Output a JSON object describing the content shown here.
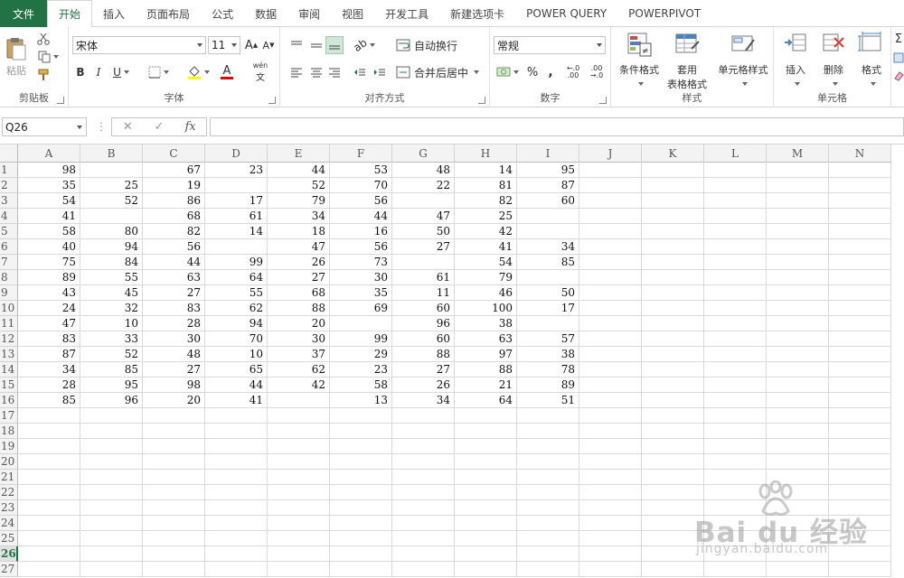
{
  "ribbon_tabs": [
    "文件",
    "开始",
    "插入",
    "页面布局",
    "公式",
    "数据",
    "审阅",
    "视图",
    "开发工具",
    "新建选项卡",
    "POWER QUERY",
    "POWERPIVOT"
  ],
  "active_tab": "开始",
  "clipboard": {
    "label": "剪贴板",
    "paste": "粘贴"
  },
  "font": {
    "label": "字体",
    "name": "宋体",
    "size": "11",
    "bold": "B",
    "italic": "I",
    "underline": "U",
    "grow": "A",
    "shrink": "A",
    "font_color": "A",
    "phonetic": "wén"
  },
  "alignment": {
    "label": "对齐方式",
    "wrap_text": "自动换行",
    "merge_center": "合并后居中"
  },
  "number": {
    "label": "数字",
    "format": "常规",
    "percent": "%",
    "comma": ",",
    "inc_decimal": "←.0 .00",
    "dec_decimal": ".00 →.0"
  },
  "styles": {
    "label": "样式",
    "conditional": "条件格式",
    "table_format_1": "套用",
    "table_format_2": "表格格式",
    "cell_styles": "单元格样式"
  },
  "cells": {
    "label": "单元格",
    "insert": "插入",
    "delete": "删除",
    "format": "格式"
  },
  "name_box": "Q26",
  "fx_label": "fx",
  "formula_value": "",
  "columns": [
    "A",
    "B",
    "C",
    "D",
    "E",
    "F",
    "G",
    "H",
    "I",
    "J",
    "K",
    "L",
    "M",
    "N"
  ],
  "row_numbers": [
    "1",
    "2",
    "3",
    "4",
    "5",
    "6",
    "7",
    "8",
    "9",
    "10",
    "11",
    "12",
    "13",
    "14",
    "15",
    "16",
    "17",
    "18",
    "19",
    "20",
    "21",
    "22",
    "23",
    "24",
    "25",
    "26",
    "27"
  ],
  "selected_row": "26",
  "rows": [
    [
      "98",
      "",
      "67",
      "23",
      "44",
      "53",
      "48",
      "14",
      "95"
    ],
    [
      "35",
      "25",
      "19",
      "",
      "52",
      "70",
      "22",
      "81",
      "87"
    ],
    [
      "54",
      "52",
      "86",
      "17",
      "79",
      "56",
      "",
      "82",
      "60"
    ],
    [
      "41",
      "",
      "68",
      "61",
      "34",
      "44",
      "47",
      "25",
      ""
    ],
    [
      "58",
      "80",
      "82",
      "14",
      "18",
      "16",
      "50",
      "42",
      ""
    ],
    [
      "40",
      "94",
      "56",
      "",
      "47",
      "56",
      "27",
      "41",
      "34"
    ],
    [
      "75",
      "84",
      "44",
      "99",
      "26",
      "73",
      "",
      "54",
      "85"
    ],
    [
      "89",
      "55",
      "63",
      "64",
      "27",
      "30",
      "61",
      "79",
      ""
    ],
    [
      "43",
      "45",
      "27",
      "55",
      "68",
      "35",
      "11",
      "46",
      "50"
    ],
    [
      "24",
      "32",
      "83",
      "62",
      "88",
      "69",
      "60",
      "100",
      "17"
    ],
    [
      "47",
      "10",
      "28",
      "94",
      "20",
      "",
      "96",
      "38",
      ""
    ],
    [
      "83",
      "33",
      "30",
      "70",
      "30",
      "99",
      "60",
      "63",
      "57"
    ],
    [
      "87",
      "52",
      "48",
      "10",
      "37",
      "29",
      "88",
      "97",
      "38"
    ],
    [
      "34",
      "85",
      "27",
      "65",
      "62",
      "23",
      "27",
      "88",
      "78"
    ],
    [
      "28",
      "95",
      "98",
      "44",
      "42",
      "58",
      "26",
      "21",
      "89"
    ],
    [
      "85",
      "96",
      "20",
      "41",
      "",
      "13",
      "34",
      "64",
      "51"
    ]
  ],
  "watermark": {
    "brand": "Bai du 经验",
    "url": "jingyan.baidu.com"
  },
  "colors": {
    "accent": "#217346",
    "grid": "#dadada",
    "header_bg": "#f3f3f3"
  }
}
